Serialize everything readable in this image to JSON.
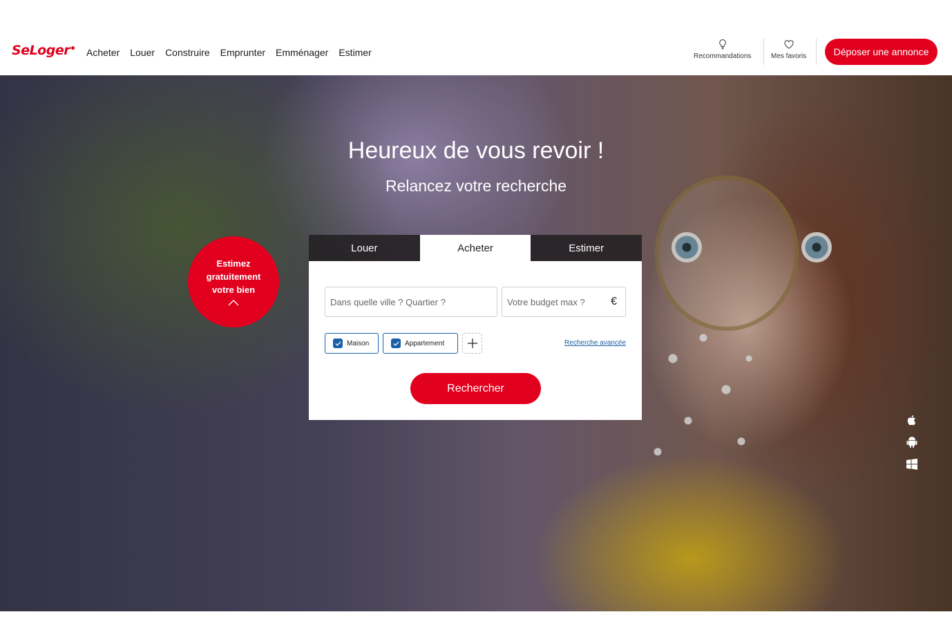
{
  "header": {
    "logo": "SeLoger",
    "nav": [
      "Acheter",
      "Louer",
      "Construire",
      "Emprunter",
      "Emménager",
      "Estimer"
    ],
    "recommendations": "Recommandations",
    "favorites": "Mes favoris",
    "deposit_button": "Déposer une annonce"
  },
  "hero": {
    "title": "Heureux de vous revoir !",
    "subtitle": "Relancez votre recherche",
    "estimate_badge": "Estimez gratuitement votre bien"
  },
  "search": {
    "tabs": [
      "Louer",
      "Acheter",
      "Estimer"
    ],
    "active_tab": "Acheter",
    "city_placeholder": "Dans quelle ville ? Quartier ?",
    "budget_placeholder": "Votre budget max ?",
    "currency": "€",
    "chips": [
      "Maison",
      "Appartement"
    ],
    "advanced": "Recherche avancée",
    "submit": "Rechercher"
  },
  "icons": {
    "recommendations": "lightbulb-icon",
    "favorites": "heart-icon",
    "stores": [
      "apple-icon",
      "android-icon",
      "windows-icon"
    ]
  },
  "colors": {
    "brand": "#e1001e",
    "accent": "#1a5fa8"
  }
}
